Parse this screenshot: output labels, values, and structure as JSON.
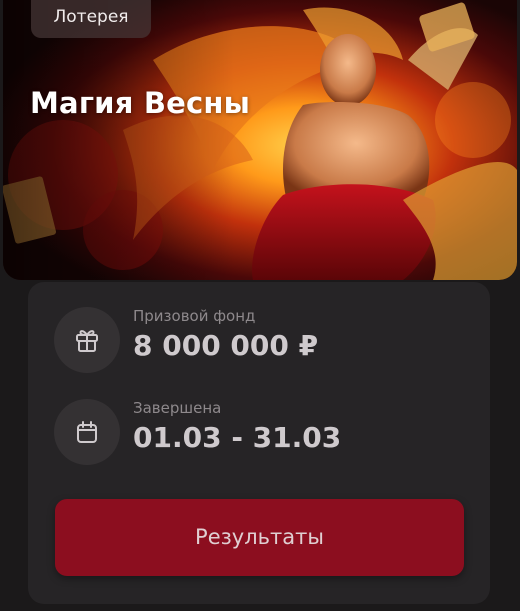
{
  "banner": {
    "tag": "Лотерея",
    "title": "Магия Весны"
  },
  "info": {
    "prize": {
      "label": "Призовой фонд",
      "value": "8 000 000 ₽",
      "icon": "gift-icon"
    },
    "status": {
      "label": "Завершена",
      "value": "01.03 - 31.03",
      "icon": "calendar-icon"
    }
  },
  "actions": {
    "results_label": "Результаты"
  },
  "colors": {
    "background": "#1b191a",
    "panel": "#262426",
    "button": "#8c0e1f"
  }
}
